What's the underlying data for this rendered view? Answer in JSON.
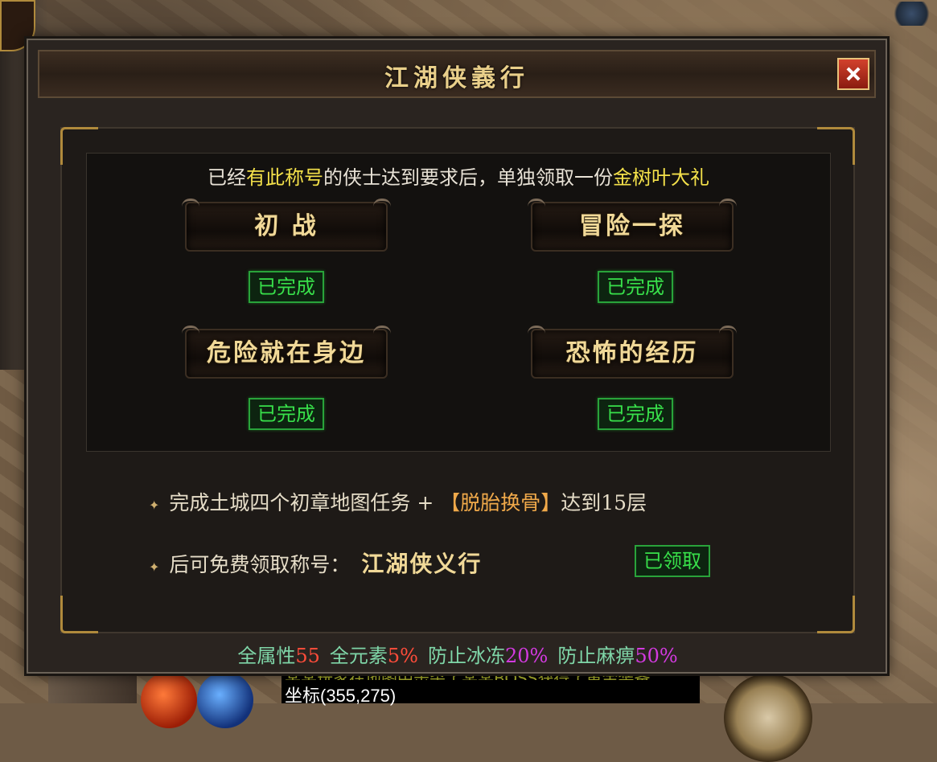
{
  "dialog": {
    "title": "江湖侠義行",
    "close_label": "×"
  },
  "intro": {
    "part1": "已经",
    "part2": "有此称号",
    "part3": "的侠士达到要求后，单独领取一份",
    "part4": "金树叶大礼"
  },
  "quests": [
    {
      "name": "初 战",
      "status": "已完成"
    },
    {
      "name": "冒险一探",
      "status": "已完成"
    },
    {
      "name": "危险就在身边",
      "status": "已完成"
    },
    {
      "name": "恐怖的经历",
      "status": "已完成"
    }
  ],
  "requirement": {
    "bullet": "✦",
    "text1": "完成土城四个初章地图任务 + ",
    "text2": "【脱胎换骨】",
    "text3": "达到15层"
  },
  "reward": {
    "bullet": "✦",
    "label": "后可免费领取称号：",
    "title_name": "江湖侠义行",
    "claim_status": "已领取"
  },
  "attributes": [
    {
      "label": "全属性",
      "value": "55"
    },
    {
      "label": "全元素",
      "value": "5%"
    },
    {
      "label": "防止冰冻",
      "value": "20%"
    },
    {
      "label": "防止麻痹",
      "value": "50%"
    }
  ],
  "hud": {
    "chat_text": "某某玩家在地图中击杀了某某BOSS获得了黄金装备",
    "coord_text": "坐标(355,275)"
  },
  "colors": {
    "highlight_yellow": "#f4e14a",
    "done_green": "#38e04a",
    "value_red": "#ff4c3a",
    "value_purple": "#d33ae0",
    "attr_label": "#7fd6a8"
  }
}
